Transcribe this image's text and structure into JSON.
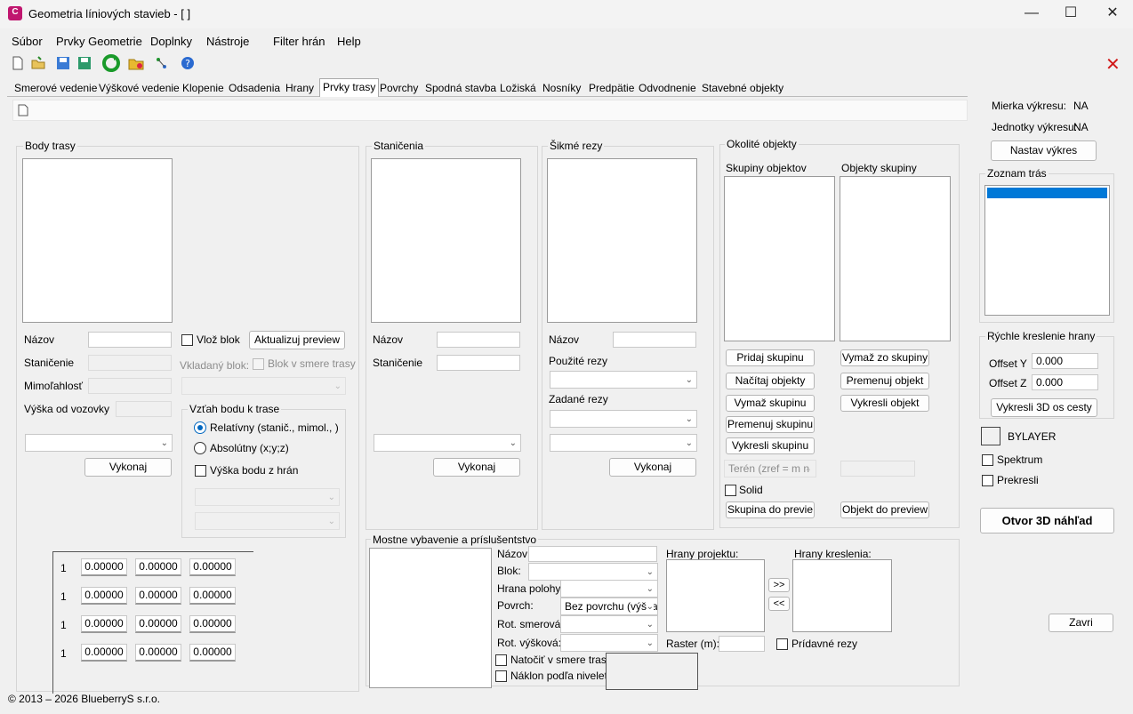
{
  "window": {
    "title": "Geometria líniových stavieb - [ ]",
    "app_icon": "C",
    "minimize": "—",
    "maximize": "☐",
    "close": "✕"
  },
  "menu": [
    "Súbor",
    "Prvky Geometrie",
    "Doplnky",
    "Nástroje",
    "Filter hrán",
    "Help"
  ],
  "toolbar_icons": [
    "new-file-icon",
    "open-folder-icon",
    "save-icon",
    "save-as-icon",
    "refresh-icon",
    "folder-settings-icon",
    "network-icon",
    "help-icon"
  ],
  "close_red": "✕",
  "tabs": [
    "Smerové vedenie",
    "Výškové vedenie",
    "Klopenie",
    "Odsadenia",
    "Hrany",
    "Prvky trasy",
    "Povrchy",
    "Spodná stavba",
    "Ložiská",
    "Nosníky",
    "Predpätie",
    "Odvodnenie",
    "Stavebné objekty"
  ],
  "active_tab": "Prvky trasy",
  "body_trasy": {
    "title": "Body trasy",
    "nazov_label": "Názov",
    "nazov_value": "",
    "stanicenie_label": "Staničenie",
    "mimoslosť_label": "Mimoľahlosť",
    "vyska_label": "Výška od vozovky",
    "vloz_blok": "Vlož blok",
    "aktualizuj": "Aktualizuj preview",
    "vkladany_blok": "Vkladaný blok:",
    "blok_smer": "Blok v smere trasy",
    "vykonaj": "Vykonaj",
    "vztah_title": "Vzťah bodu k trase",
    "relativny": "Relatívny (stanič., mimol., )",
    "absolutny": "Absolútny (x;y;z)",
    "vyska_z_hran": "Výška bodu z hrán",
    "grid": [
      {
        "n": "1",
        "a": "0.00000",
        "b": "0.00000",
        "c": "0.00000"
      },
      {
        "n": "1",
        "a": "0.00000",
        "b": "0.00000",
        "c": "0.00000"
      },
      {
        "n": "1",
        "a": "0.00000",
        "b": "0.00000",
        "c": "0.00000"
      },
      {
        "n": "1",
        "a": "0.00000",
        "b": "0.00000",
        "c": "0.00000"
      }
    ]
  },
  "stanicenia": {
    "title": "Staničenia",
    "nazov": "Názov",
    "stanicenie": "Staničenie",
    "vykonaj": "Vykonaj"
  },
  "sikme": {
    "title": "Šikmé rezy",
    "nazov": "Názov",
    "pouzite": "Použité rezy",
    "zadane": "Zadané rezy",
    "vykonaj": "Vykonaj"
  },
  "okolite": {
    "title": "Okolité objekty",
    "skupiny": "Skupiny objektov",
    "objekty": "Objekty skupiny",
    "pridaj": "Pridaj skupinu",
    "nacitaj": "Načítaj objekty",
    "vymaz": "Vymaž skupinu",
    "premenuj": "Premenuj skupinu",
    "vykresli": "Vykresli skupinu",
    "vymaz_zo": "Vymaž zo skupiny",
    "premenuj_obj": "Premenuj objekt",
    "vykresli_obj": "Vykresli objekt",
    "teren": "Terén (zref = m n",
    "solid": "Solid",
    "skupina_prev": "Skupina  do previe",
    "objekt_prev": "Objekt do preview"
  },
  "mostne": {
    "title": "Mostne vybavenie a príslušentstvo",
    "nazov": "Názov:",
    "blok": "Blok:",
    "hrana": "Hrana polohy:",
    "povrch": "Povrch:",
    "povrch_val": "Bez povrchu (výška",
    "rot_smer": "Rot. smerová:",
    "rot_vysk": "Rot. výšková:",
    "natocit": "Natočiť v smere trasy",
    "naklon": "Náklon podľa nivelety",
    "hrany_proj": "Hrany projektu:",
    "hrany_kresl": "Hrany kreslenia:",
    "raster": "Raster (m):",
    "pridavne": "Prídavné rezy",
    "add": ">>",
    "remove": "<<"
  },
  "right": {
    "mierka_label": "Mierka výkresu:",
    "mierka_val": "NA",
    "jednotky_label": "Jednotky výkresu:",
    "jednotky_val": "NA",
    "nastav": "Nastav výkres",
    "zoznam": "Zoznam trás",
    "rychle": "Rýchle kreslenie hrany",
    "offset_y": "Offset Y",
    "offset_y_val": "0.000",
    "offset_z": "Offset Z",
    "offset_z_val": "0.000",
    "vykresli3d": "Vykresli 3D os cesty",
    "bylayer": "BYLAYER",
    "spektrum": "Spektrum",
    "prekresli": "Prekresli",
    "otvor": "Otvor 3D náhľad",
    "zavri": "Zavri"
  },
  "status": "© 2013 – 2026 BlueberryS s.r.o.",
  "colors": {
    "accent": "#0067c0",
    "selection": "#0078d7",
    "close_red": "#d11919"
  }
}
